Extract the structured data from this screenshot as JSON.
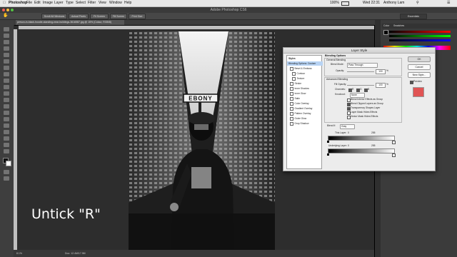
{
  "menubar": {
    "app": "Photoshop",
    "items": [
      "File",
      "Edit",
      "Image",
      "Layer",
      "Type",
      "Select",
      "Filter",
      "View",
      "Window",
      "Help"
    ],
    "battery": "100%",
    "clock": "Wed 22:31",
    "user": "Anthony Lam"
  },
  "window_title": "Adobe Photoshop CS6",
  "options_bar": {
    "buttons": [
      "Scroll All Windows",
      "Actual Pixels",
      "Fit Screen",
      "Fill Screen",
      "Print Size"
    ],
    "workspace": "Essentials"
  },
  "document": {
    "tab_label": "person-in-black-hoodie-standing-near-buildings-3616587.jpg @ 15% (Colour, RGB/8)",
    "status_zoom": "8.1%",
    "status_doc": "Doc: 12.4M/17.9M",
    "sign_text": "EBONY"
  },
  "right_panels": {
    "tabs": [
      "Color",
      "Swatches"
    ]
  },
  "dialog": {
    "title": "Layer Style",
    "styles_header": "Styles",
    "styles": [
      {
        "label": "Blending Options: Custom",
        "checkbox": false,
        "selected": true
      },
      {
        "label": "Bevel & Emboss",
        "checkbox": true
      },
      {
        "label": "Contour",
        "checkbox": true,
        "sub": true
      },
      {
        "label": "Texture",
        "checkbox": true,
        "sub": true
      },
      {
        "label": "Stroke",
        "checkbox": true
      },
      {
        "label": "Inner Shadow",
        "checkbox": true
      },
      {
        "label": "Inner Glow",
        "checkbox": true
      },
      {
        "label": "Satin",
        "checkbox": true
      },
      {
        "label": "Color Overlay",
        "checkbox": true
      },
      {
        "label": "Gradient Overlay",
        "checkbox": true
      },
      {
        "label": "Pattern Overlay",
        "checkbox": true
      },
      {
        "label": "Outer Glow",
        "checkbox": true
      },
      {
        "label": "Drop Shadow",
        "checkbox": true
      }
    ],
    "blending_options_title": "Blending Options",
    "general_blending": "General Blending",
    "blend_mode_label": "Blend Mode:",
    "blend_mode_value": "Pass Through",
    "opacity_label": "Opacity:",
    "opacity_value": "100",
    "percent": "%",
    "advanced_blending": "Advanced Blending",
    "fill_opacity_label": "Fill Opacity:",
    "fill_opacity_value": "100",
    "channels_label": "Channels:",
    "channel_r": "R",
    "channel_g": "G",
    "channel_b": "B",
    "knockout_label": "Knockout:",
    "knockout_value": "None",
    "advanced_checks": [
      {
        "label": "Blend Interior Effects as Group",
        "checked": false
      },
      {
        "label": "Blend Clipped Layers as Group",
        "checked": true
      },
      {
        "label": "Transparency Shapes Layer",
        "checked": true
      },
      {
        "label": "Layer Mask Hides Effects",
        "checked": false
      },
      {
        "label": "Vector Mask Hides Effects",
        "checked": false
      }
    ],
    "blend_if_label": "Blend If:",
    "blend_if_value": "Gray",
    "this_layer_label": "This Layer:",
    "this_layer_low": "0",
    "this_layer_high": "255",
    "underlying_label": "Underlying Layer:",
    "underlying_low": "0",
    "underlying_high": "255",
    "buttons": {
      "ok": "OK",
      "cancel": "Cancel",
      "new_style": "New Style...",
      "preview": "Preview"
    },
    "preview_checked": true,
    "preview_color": "#e05454"
  },
  "caption": "Untick \"R\""
}
